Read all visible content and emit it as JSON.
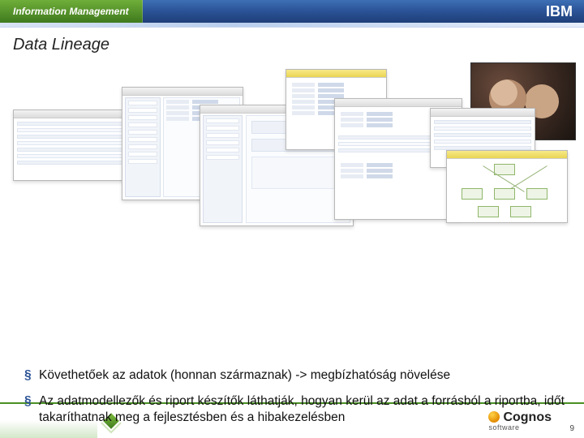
{
  "topbar": {
    "tab_label": "Information Management",
    "brand": "IBM"
  },
  "slide": {
    "title": "Data Lineage"
  },
  "bullets": [
    "Követhetőek az adatok (honnan származnak) -> megbízhatóság növelése",
    "Az adatmodellezők és riport készítők láthatják, hogyan kerül az adat a forrásból a riportba, időt takaríthatnak meg a fejlesztésben és a hibakezelésben"
  ],
  "footer": {
    "logo_line1": "Cognos",
    "logo_line2": "software",
    "page_number": "9"
  }
}
